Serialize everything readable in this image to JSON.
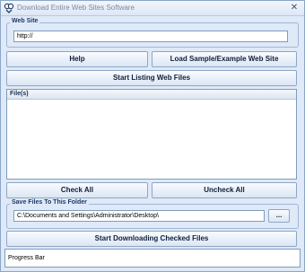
{
  "window": {
    "title": "Download Entire Web Sites Software",
    "close_glyph": "✕"
  },
  "website_group": {
    "label": "Web Site",
    "url_value": "http://"
  },
  "buttons": {
    "help": "Help",
    "load_sample": "Load Sample/Example Web Site",
    "start_listing": "Start Listing Web Files",
    "check_all": "Check All",
    "uncheck_all": "Uncheck All",
    "browse": "...",
    "start_downloading": "Start Downloading Checked Files"
  },
  "file_list": {
    "header": "File(s)",
    "items": []
  },
  "save_group": {
    "label": "Save Files To This Folder",
    "folder_path": "C:\\Documents and Settings\\Administrator\\Desktop\\"
  },
  "progress": {
    "label": "Progress Bar",
    "value": 0
  },
  "icons": {
    "app": "app-icon",
    "close": "close-icon"
  },
  "colors": {
    "background": "#dfe9f7",
    "border": "#8aa6c8",
    "group_label": "#1f3a66"
  }
}
